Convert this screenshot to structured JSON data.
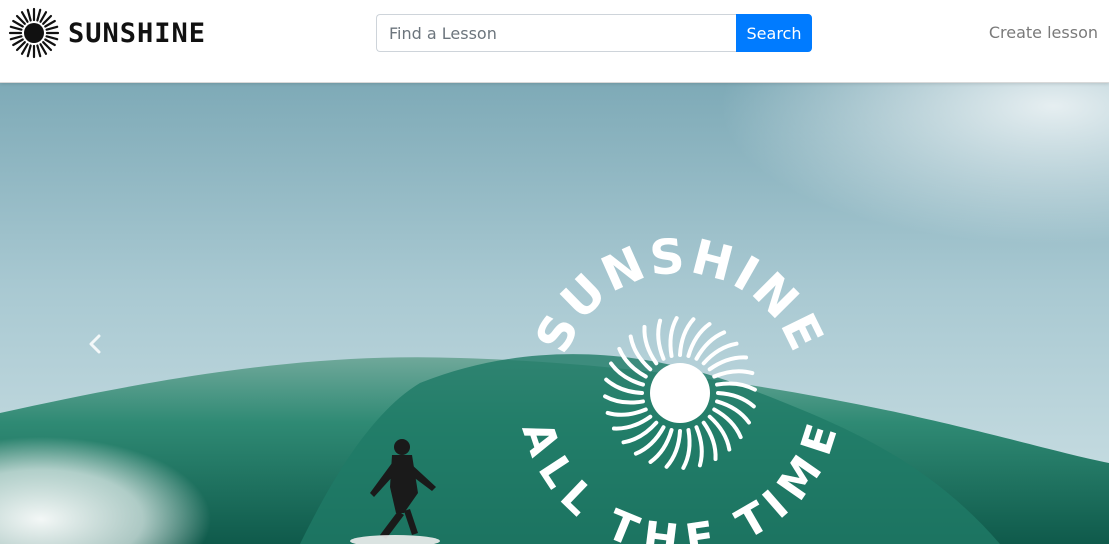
{
  "brand": {
    "name": "SUNSHINE",
    "logo_icon": "sunburst-icon"
  },
  "search": {
    "placeholder": "Find a Lesson",
    "value": "",
    "button_label": "Search"
  },
  "nav": {
    "create_lesson": "Create lesson"
  },
  "hero": {
    "image": "surfer-in-wave",
    "badge_top_text": "SUNSHINE",
    "badge_bottom_text": "ALL THE TIME",
    "prev_icon": "chevron-left-icon"
  },
  "colors": {
    "primary": "#007bff",
    "nav_link": "#7a7a7a",
    "brand_text": "#111111"
  }
}
